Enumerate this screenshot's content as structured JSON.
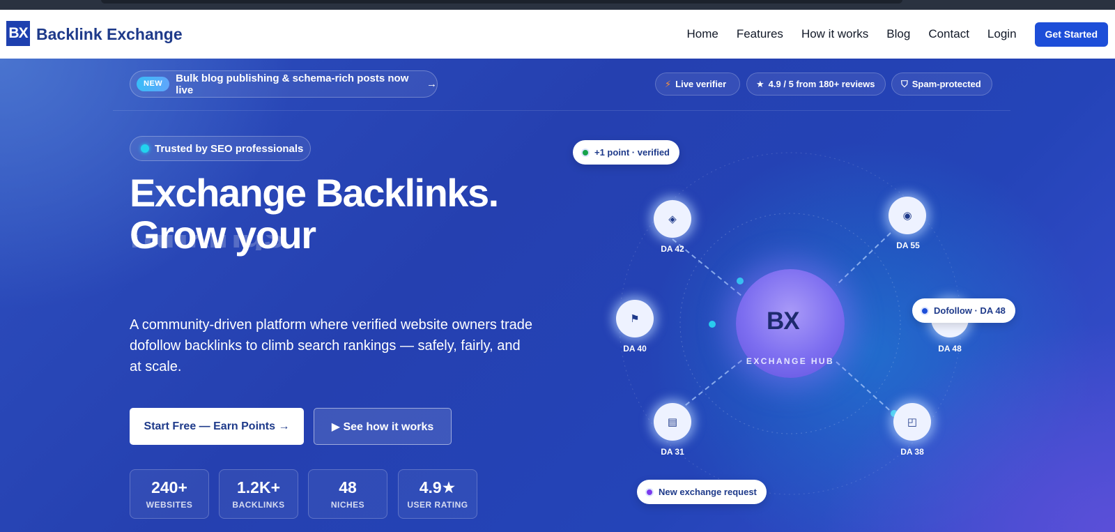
{
  "nav": {
    "logo": "BX",
    "brand": "Backlink Exchange",
    "links": [
      "Home",
      "Features",
      "How it works",
      "Blog",
      "Contact",
      "Login"
    ],
    "cta": "Get Started"
  },
  "announce": {
    "badge": "NEW",
    "text": "Bulk blog publishing & schema-rich posts now live",
    "arrow": "→"
  },
  "chips": [
    {
      "icon": "bolt-icon",
      "glyph": "⚡",
      "text": "Live verifier"
    },
    {
      "icon": "star-icon",
      "glyph": "★",
      "text": "4.9 / 5 from 180+ reviews"
    },
    {
      "icon": "shield-icon",
      "glyph": "⛉",
      "text": "Spam-protected"
    }
  ],
  "hero": {
    "trusted": "Trusted by SEO professionals",
    "headline_1": "Exchange Backlinks.",
    "headline_2": "Grow your",
    "ghost_text": "rankings",
    "description": "A community-driven platform where verified website owners trade dofollow backlinks to climb search rankings — safely, fairly, and at scale.",
    "primary_cta": "Start Free — Earn Points →",
    "secondary_cta": "▶ See how it works"
  },
  "stats": [
    {
      "value": "240+",
      "label": "WEBSITES"
    },
    {
      "value": "1.2K+",
      "label": "BACKLINKS"
    },
    {
      "value": "48",
      "label": "NICHES"
    },
    {
      "value": "4.9★",
      "label": "USER RATING"
    }
  ],
  "hub": {
    "logo": "BX",
    "label": "EXCHANGE HUB",
    "nodes": [
      {
        "icon": "diamond-icon",
        "glyph": "◈",
        "label": "DA 42"
      },
      {
        "icon": "target-icon",
        "glyph": "◉",
        "label": "DA 55"
      },
      {
        "icon": "flag-icon",
        "glyph": "⚑",
        "label": "DA 40"
      },
      {
        "icon": "globe-icon",
        "glyph": "",
        "label": "DA 48"
      },
      {
        "icon": "document-icon",
        "glyph": "▤",
        "label": "DA 31"
      },
      {
        "icon": "layout-icon",
        "glyph": "◰",
        "label": "DA 38"
      }
    ],
    "toasts": [
      {
        "text": "+1 point · verified",
        "color": "#16a34a"
      },
      {
        "text": "Dofollow · DA 48",
        "color": "#1d4ed8"
      },
      {
        "text": "New exchange request",
        "color": "#7c3aed"
      }
    ]
  }
}
